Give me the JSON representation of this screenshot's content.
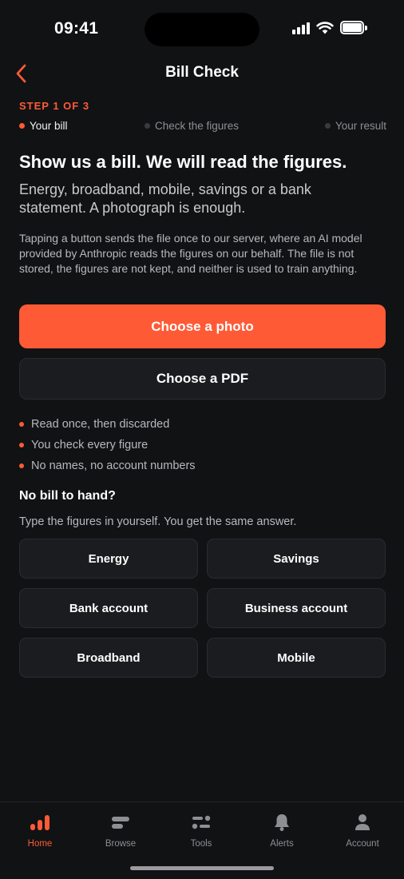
{
  "status_bar": {
    "time": "09:41"
  },
  "nav": {
    "title": "Bill Check",
    "back_icon": "chevron-left-icon"
  },
  "steps": {
    "label": "STEP 1 OF 3",
    "items": [
      "Your bill",
      "Check the figures",
      "Your result"
    ],
    "current": 1
  },
  "intro": {
    "headline": "Show us a bill. We will read the figures.",
    "subhead": "Energy, broadband, mobile, savings or a bank statement. A photograph is enough.",
    "notice": "Tapping a button sends the file once to our server, where an AI model provided by Anthropic reads the figures on our behalf. The file is not stored, the figures are not kept, and neither is used to train anything."
  },
  "actions": {
    "photo_label": "Choose a photo",
    "pdf_label": "Choose a PDF"
  },
  "bullets": [
    "Read once, then discarded",
    "You check every figure",
    "No names, no account numbers"
  ],
  "manual": {
    "title": "No bill to hand?",
    "subtitle": "Type the figures in yourself. You get the same answer.",
    "options": [
      "Energy",
      "Savings",
      "Bank account",
      "Business account",
      "Broadband",
      "Mobile"
    ]
  },
  "tabbar": {
    "items": [
      {
        "label": "Home",
        "icon": "bar-chart-icon",
        "active": true
      },
      {
        "label": "Browse",
        "icon": "browse-icon",
        "active": false
      },
      {
        "label": "Tools",
        "icon": "sliders-icon",
        "active": false
      },
      {
        "label": "Alerts",
        "icon": "bell-icon",
        "active": false
      },
      {
        "label": "Account",
        "icon": "person-icon",
        "active": false
      }
    ]
  },
  "colors": {
    "accent": "#ff5a36",
    "background": "#111214",
    "surface": "#1b1c1f"
  }
}
